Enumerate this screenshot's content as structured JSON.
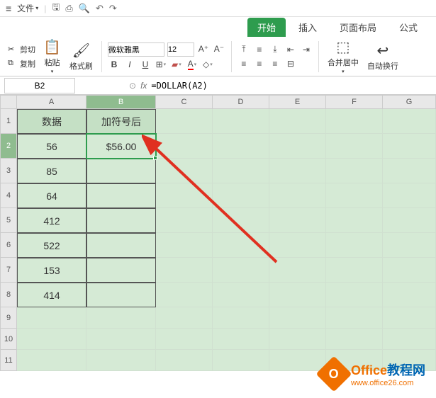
{
  "menubar": {
    "file": "文件"
  },
  "tabs": {
    "start": "开始",
    "insert": "插入",
    "layout": "页面布局",
    "formula": "公式"
  },
  "ribbon": {
    "cut": "剪切",
    "copy": "复制",
    "paste": "粘贴",
    "formatPainter": "格式刷",
    "fontname": "微软雅黑",
    "fontsize": "12",
    "mergeCenter": "合并居中",
    "autoWrap": "自动换行"
  },
  "formulabar": {
    "cellref": "B2",
    "formula": "=DOLLAR(A2)"
  },
  "columns": [
    "A",
    "B",
    "C",
    "D",
    "E",
    "F",
    "G"
  ],
  "rowNums": [
    "1",
    "2",
    "3",
    "4",
    "5",
    "6",
    "7",
    "8",
    "9",
    "10",
    "11"
  ],
  "table": {
    "headers": [
      "数据",
      "加符号后"
    ],
    "colA": [
      "56",
      "85",
      "64",
      "412",
      "522",
      "153",
      "414"
    ],
    "b2": "$56.00"
  },
  "watermark": {
    "title1": "Office",
    "title2": "教程网",
    "url": "www.office26.com"
  }
}
